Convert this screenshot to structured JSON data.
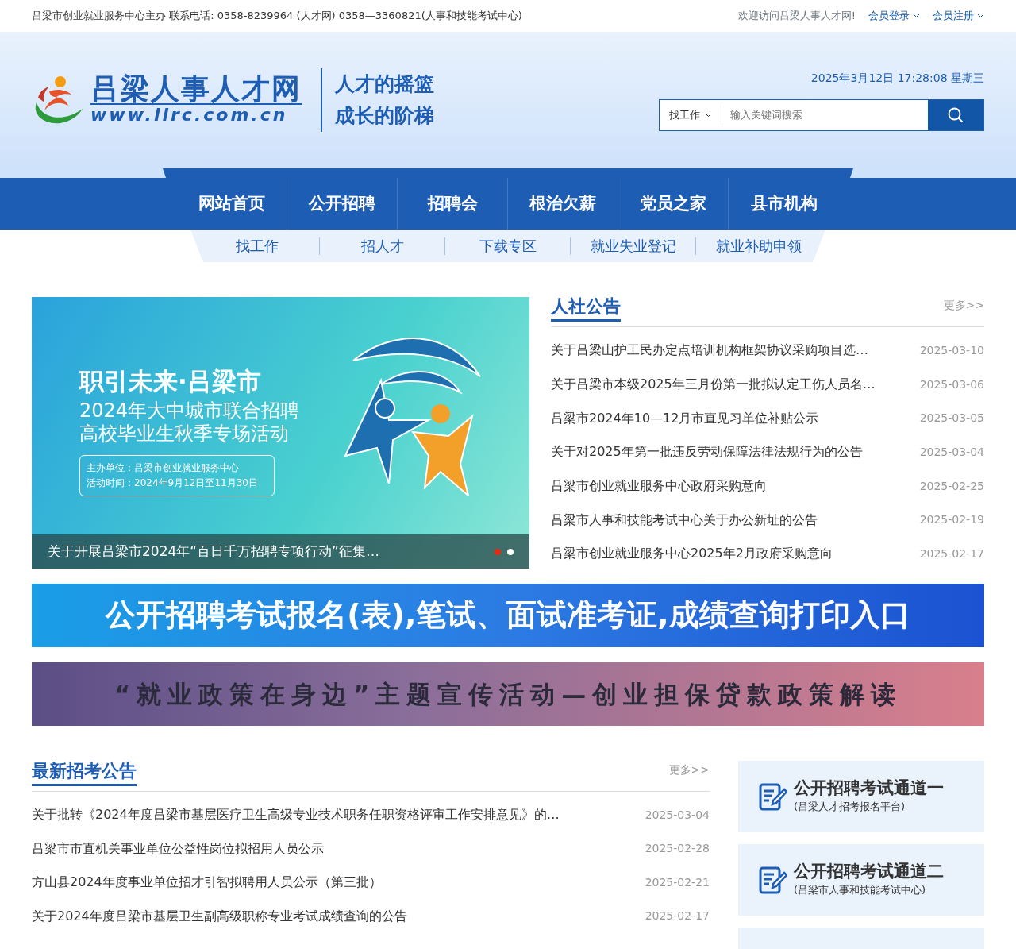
{
  "top_bar": {
    "sponsor": "吕梁市创业就业服务中心主办 联系电话: 0358-8239964 (人才网) 0358—3360821(人事和技能考试中心)",
    "welcome": "欢迎访问吕梁人事人才网!",
    "links": [
      "会员登录",
      "会员注册"
    ]
  },
  "header": {
    "logo_title": "吕梁人事人才网",
    "logo_url": "www.llrc.com.cn",
    "slogans": [
      "人才的摇篮",
      "成长的阶梯"
    ],
    "datetime": "2025年3月12日 17:28:08 星期三",
    "search": {
      "category": "找工作",
      "placeholder": "输入关键词搜索"
    }
  },
  "main_nav": [
    {
      "label": "网站首页",
      "selected": false
    },
    {
      "label": "公开招聘",
      "selected": false
    },
    {
      "label": "招聘会",
      "selected": false
    },
    {
      "label": "根治欠薪",
      "selected": false
    },
    {
      "label": "党员之家",
      "selected": false
    },
    {
      "label": "县市机构",
      "selected": false
    }
  ],
  "sub_nav": [
    "找工作",
    "招人才",
    "下载专区",
    "就业失业登记",
    "就业补助申领"
  ],
  "slider": {
    "headline": "职引未来·吕梁市",
    "subtitle_lines": [
      "2024年大中城市联合招聘",
      "高校毕业生秋季专场活动"
    ],
    "info_lines": [
      "主办单位：吕梁市创业就业服务中心",
      "活动时间：2024年9月12日至11月30日"
    ],
    "caption": "关于开展吕梁市2024年“百日千万招聘专项行动”征集…",
    "dots": [
      {
        "selected": true
      },
      {
        "selected": false
      }
    ]
  },
  "notices": {
    "title": "人社公告",
    "more": "更多>>",
    "items": [
      {
        "title": "关于吕梁山护工民办定点培训机构框架协议采购项目选…",
        "date": "2025-03-10"
      },
      {
        "title": "关于吕梁市本级2025年三月份第一批拟认定工伤人员名…",
        "date": "2025-03-06"
      },
      {
        "title": "吕梁市2024年10—12月市直见习单位补贴公示",
        "date": "2025-03-05"
      },
      {
        "title": "关于对2025年第一批违反劳动保障法律法规行为的公告",
        "date": "2025-03-04"
      },
      {
        "title": "吕梁市创业就业服务中心政府采购意向",
        "date": "2025-02-25"
      },
      {
        "title": "吕梁市人事和技能考试中心关于办公新址的公告",
        "date": "2025-02-19"
      },
      {
        "title": "吕梁市创业就业服务中心2025年2月政府采购意向",
        "date": "2025-02-17"
      }
    ]
  },
  "banners": [
    {
      "kind": "exam",
      "text": "公开招聘考试报名(表),笔试、面试准考证,成绩查询打印入口"
    },
    {
      "kind": "policy",
      "text": "“就业政策在身边”主题宣传活动—创业担保贷款政策解读"
    }
  ],
  "exam_notices": {
    "title": "最新招考公告",
    "more": "更多>>",
    "items": [
      {
        "title": "关于批转《2024年度吕梁市基层医疗卫生高级专业技术职务任职资格评审工作安排意见》的…",
        "date": "2025-03-04"
      },
      {
        "title": "吕梁市市直机关事业单位公益性岗位拟招用人员公示",
        "date": "2025-02-28"
      },
      {
        "title": "方山县2024年度事业单位招才引智拟聘用人员公示（第三批）",
        "date": "2025-02-21"
      },
      {
        "title": "关于2024年度吕梁市基层卫生副高级职称专业考试成绩查询的公告",
        "date": "2025-02-17"
      }
    ]
  },
  "channels": [
    {
      "title": "公开招聘考试通道一",
      "subtitle": "(吕梁人才招考报名平台)"
    },
    {
      "title": "公开招聘考试通道二",
      "subtitle": "(吕梁市人事和技能考试中心)"
    }
  ]
}
